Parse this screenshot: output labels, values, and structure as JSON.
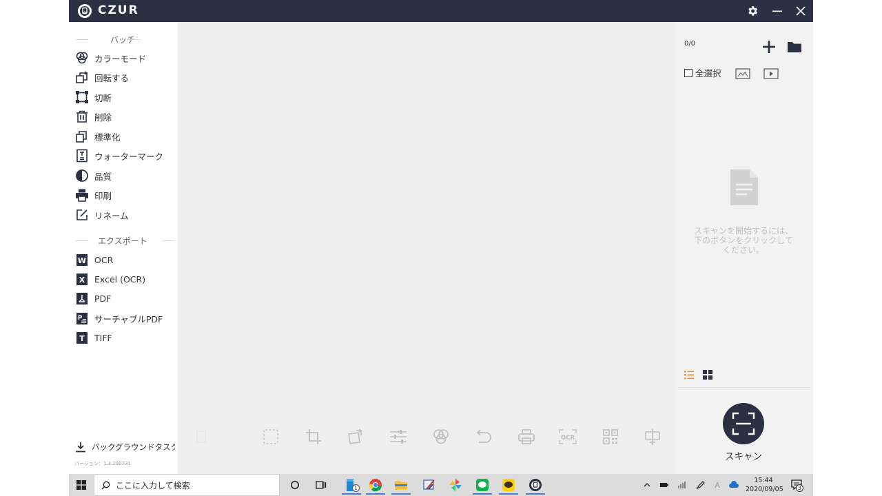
{
  "app": {
    "brand": "CZUR",
    "colors": {
      "titlebar": "#2c3043",
      "accent_orange": "#f08a2a",
      "icon_dark": "#2c3043"
    }
  },
  "sidebar": {
    "batch_title": "バッチ",
    "batch_items": [
      {
        "label": "カラーモード",
        "icon": "color-mode-icon"
      },
      {
        "label": "回転する",
        "icon": "rotate-icon"
      },
      {
        "label": "切断",
        "icon": "crop-icon"
      },
      {
        "label": "削除",
        "icon": "trash-icon"
      },
      {
        "label": "標準化",
        "icon": "standardize-icon"
      },
      {
        "label": "ウォーターマーク",
        "icon": "watermark-icon"
      },
      {
        "label": "品質",
        "icon": "quality-icon"
      },
      {
        "label": "印刷",
        "icon": "print-icon"
      },
      {
        "label": "リネーム",
        "icon": "rename-icon"
      }
    ],
    "export_title": "エクスポート",
    "export_items": [
      {
        "label": "OCR",
        "icon": "word-icon"
      },
      {
        "label": "Excel (OCR)",
        "icon": "excel-icon"
      },
      {
        "label": "PDF",
        "icon": "pdf-icon"
      },
      {
        "label": "サーチャブルPDF",
        "icon": "searchable-pdf-icon"
      },
      {
        "label": "TIFF",
        "icon": "tiff-icon"
      }
    ],
    "background_task": "バックグラウンドタスク",
    "version": "バージョン：1.3.200731"
  },
  "right_panel": {
    "counter": "0/0",
    "select_all": "全選択",
    "empty_message": "スキャンを開始するには、下のボタンをクリックしてください。",
    "scan_label": "スキャン"
  },
  "taskbar": {
    "search_placeholder": "ここに入力して検索",
    "ime_indicator": "A",
    "time": "15:44",
    "date": "2020/09/05",
    "notification_count": "3",
    "explorer_badge": "1"
  }
}
